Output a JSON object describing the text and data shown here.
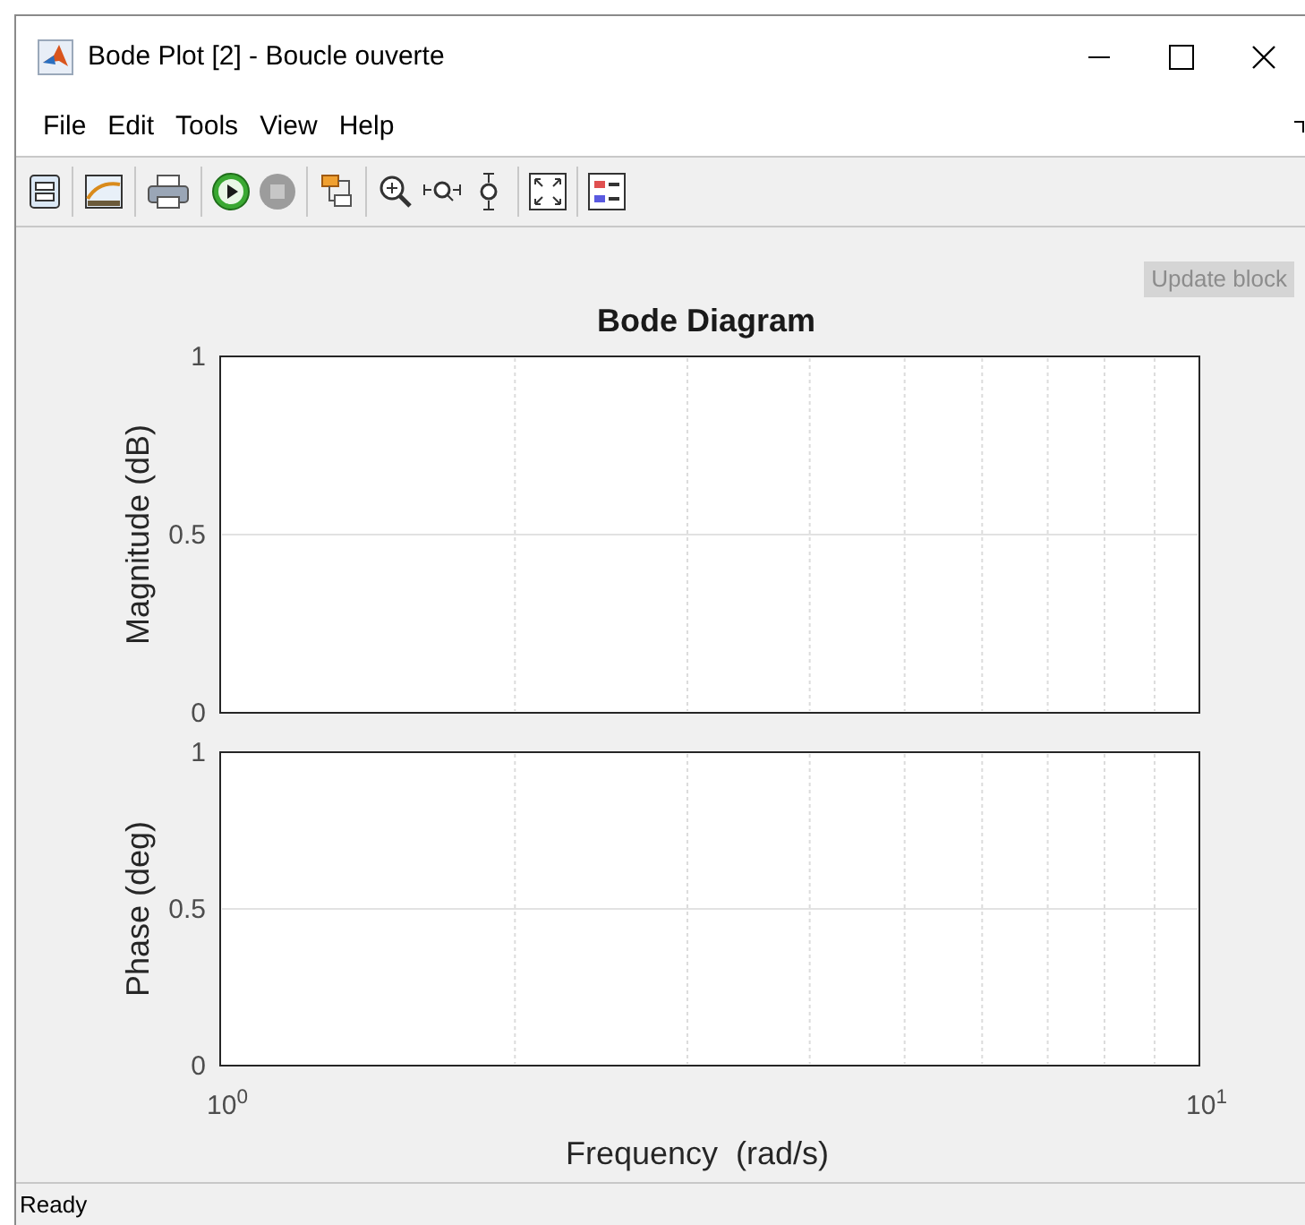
{
  "window": {
    "title": "Bode Plot [2] - Boucle ouverte"
  },
  "menu": [
    "File",
    "Edit",
    "Tools",
    "View",
    "Help"
  ],
  "update_button": {
    "label": "Update block",
    "disabled": true
  },
  "figure": {
    "title": "Bode Diagram",
    "charts": [
      {
        "chart_data": {
          "type": "line",
          "ylabel": "Magnitude (dB)",
          "xlim": [
            1,
            10
          ],
          "ylim": [
            0,
            1
          ],
          "yticks": [
            0,
            0.5,
            1
          ]
        }
      },
      {
        "chart_data": {
          "type": "line",
          "xlabel": "Frequency  (rad/s)",
          "ylabel": "Phase (deg)",
          "xlim": [
            1,
            10
          ],
          "ylim": [
            0,
            1
          ],
          "yticks": [
            0,
            0.5,
            1
          ],
          "xticks": [
            {
              "value": 1,
              "label": "10$^{0}$"
            },
            {
              "value": 10,
              "label": "10$^{1}$"
            }
          ]
        }
      }
    ]
  },
  "status_bar": "Ready"
}
